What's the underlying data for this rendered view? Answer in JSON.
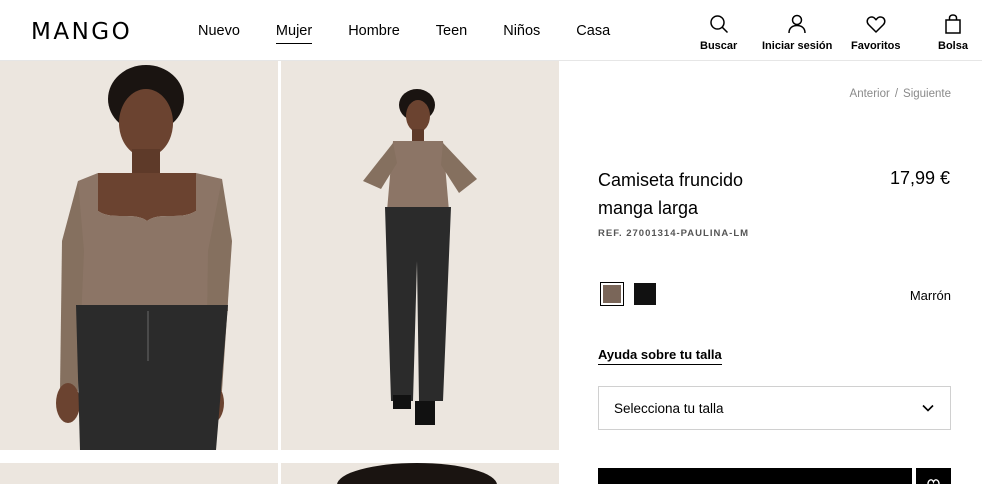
{
  "brand": {
    "logo": "MANGO"
  },
  "nav": [
    {
      "label": "Nuevo",
      "active": false
    },
    {
      "label": "Mujer",
      "active": true
    },
    {
      "label": "Hombre",
      "active": false
    },
    {
      "label": "Teen",
      "active": false
    },
    {
      "label": "Niños",
      "active": false
    },
    {
      "label": "Casa",
      "active": false
    }
  ],
  "header_actions": {
    "search": {
      "label": "Buscar",
      "icon": "search-icon"
    },
    "login": {
      "label": "Iniciar sesión",
      "icon": "user-icon"
    },
    "favorites": {
      "label": "Favoritos",
      "icon": "heart-icon"
    },
    "bag": {
      "label": "Bolsa",
      "icon": "bag-icon"
    }
  },
  "pagination": {
    "prev": "Anterior",
    "separator": "/",
    "next": "Siguiente"
  },
  "product": {
    "title": "Camiseta fruncido manga larga",
    "price": "17,99 €",
    "ref": "REF. 27001314-PAULINA-LM",
    "colors": [
      {
        "name": "Marrón",
        "hex": "#7a6659",
        "selected": true
      },
      {
        "name": "Negro",
        "hex": "#111111",
        "selected": false
      }
    ],
    "selected_color_name": "Marrón",
    "size_help": "Ayuda sobre tu talla",
    "size_select_placeholder": "Selecciona tu talla"
  },
  "colors": {
    "photo_bg": "#ece6df",
    "top_brown": "#8c7566",
    "jeans": "#2b2b2b",
    "skin": "#6b4330",
    "hair": "#1a1411"
  }
}
